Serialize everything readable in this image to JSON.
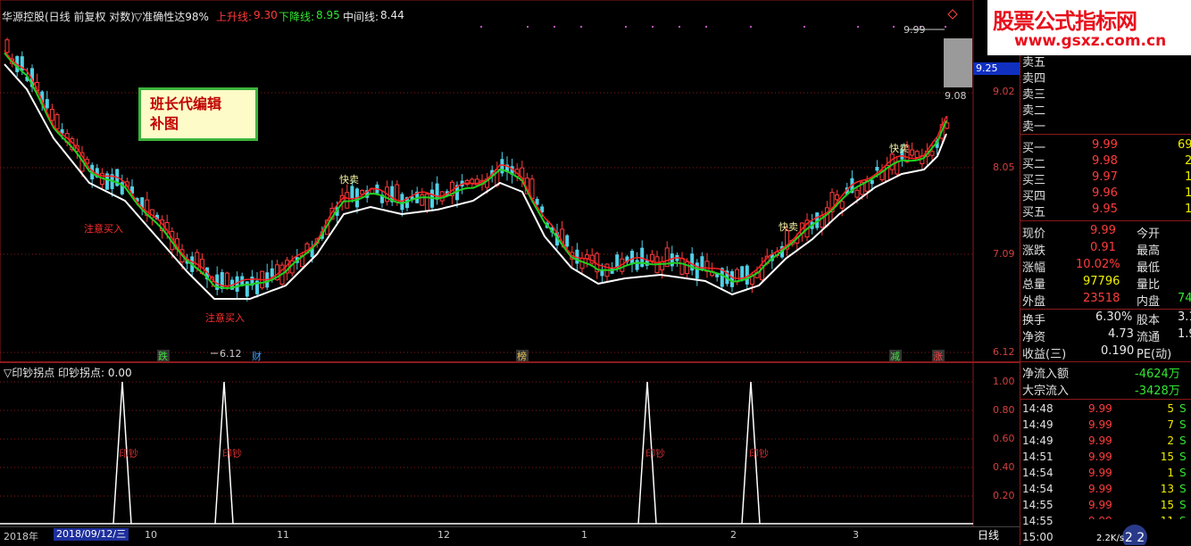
{
  "header": {
    "stock": "华源控股(日线 前复权 对数)",
    "indicator": "▽准确性达98%",
    "up_label": "上升线:",
    "up_val": "9.30",
    "down_label": "下降线:",
    "down_val": "8.95",
    "mid_label": "中间线:",
    "mid_val": "8.44"
  },
  "chart": {
    "note_line1": "班长代编辑",
    "note_line2": "补图",
    "high_label": "9.99",
    "prev_label": "9.08",
    "low_label": "6.12",
    "signals": {
      "buy1": "注意买入",
      "buy2": "注意买入",
      "sell1": "快卖",
      "sell2": "快卖",
      "sell3": "快卖"
    },
    "markers": [
      "跌",
      "财",
      "榜",
      "减",
      "涨"
    ],
    "price_axis": [
      "9.25",
      "9.02",
      "8.05",
      "7.09",
      "6.12"
    ],
    "current_price_box": "9.25"
  },
  "watermark": {
    "title": "股票公式指标网",
    "url": "www.gsxz.com.cn"
  },
  "sub": {
    "title": "▽印钞拐点  印钞拐点: 0.00",
    "axis": [
      "1.00",
      "0.80",
      "0.60",
      "0.40",
      "0.20"
    ],
    "peak_label": "印钞"
  },
  "dates": {
    "year": "2018年",
    "selected": "2018/09/12/三",
    "months": [
      "10",
      "11",
      "12",
      "1",
      "2",
      "3"
    ],
    "period": "日线"
  },
  "quote": {
    "sell": [
      {
        "label": "卖五"
      },
      {
        "label": "卖四"
      },
      {
        "label": "卖三"
      },
      {
        "label": "卖二"
      },
      {
        "label": "卖一"
      }
    ],
    "buy": [
      {
        "label": "买一",
        "price": "9.99",
        "vol": "69"
      },
      {
        "label": "买二",
        "price": "9.98",
        "vol": "2"
      },
      {
        "label": "买三",
        "price": "9.97",
        "vol": "1"
      },
      {
        "label": "买四",
        "price": "9.96",
        "vol": "1"
      },
      {
        "label": "买五",
        "price": "9.95",
        "vol": "1"
      }
    ],
    "stats": [
      {
        "l1": "现价",
        "v1": "9.99",
        "l2": "今开"
      },
      {
        "l1": "涨跌",
        "v1": "0.91",
        "l2": "最高"
      },
      {
        "l1": "涨幅",
        "v1": "10.02%",
        "l2": "最低"
      },
      {
        "l1": "总量",
        "v1": "97796",
        "l2": "量比"
      },
      {
        "l1": "外盘",
        "v1": "23518",
        "l2": "内盘",
        "v2": "74"
      }
    ],
    "stats2": [
      {
        "l1": "换手",
        "v1": "6.30%",
        "l2": "股本",
        "v2": "3.1"
      },
      {
        "l1": "净资",
        "v1": "4.73",
        "l2": "流通",
        "v2": "1.9"
      },
      {
        "l1": "收益(三)",
        "v1": "0.190",
        "l2": "PE(动)"
      }
    ],
    "flow": [
      {
        "label": "净流入额",
        "value": "-4624万"
      },
      {
        "label": "大宗流入",
        "value": "-3428万"
      }
    ],
    "ticks": [
      {
        "time": "14:48",
        "price": "9.99",
        "vol": "5",
        "side": "S"
      },
      {
        "time": "14:49",
        "price": "9.99",
        "vol": "7",
        "side": "S"
      },
      {
        "time": "14:49",
        "price": "9.99",
        "vol": "2",
        "side": "S"
      },
      {
        "time": "14:51",
        "price": "9.99",
        "vol": "15",
        "side": "S"
      },
      {
        "time": "14:54",
        "price": "9.99",
        "vol": "1",
        "side": "S"
      },
      {
        "time": "14:54",
        "price": "9.99",
        "vol": "13",
        "side": "S"
      },
      {
        "time": "14:55",
        "price": "9.99",
        "vol": "15",
        "side": "S"
      },
      {
        "time": "14:55",
        "price": "9.99",
        "vol": "11",
        "side": "S"
      },
      {
        "time": "15:00",
        "price": "",
        "vol": "",
        "side": ""
      }
    ]
  },
  "status": {
    "speed": "2.2K/s"
  },
  "colors": {
    "up": "#ff3c3c",
    "down": "#4fd0e6",
    "ma_red": "#ff2020",
    "ma_green": "#20d020",
    "ma_white": "#ffffff",
    "grid": "#8b1a1a"
  }
}
